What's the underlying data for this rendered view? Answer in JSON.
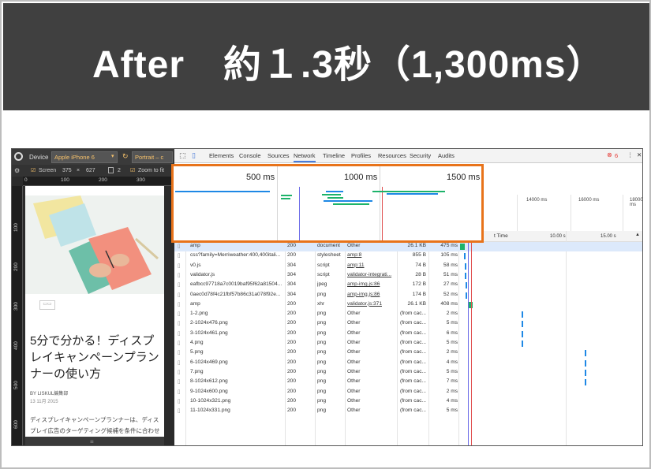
{
  "banner": {
    "title": "After　約１.3秒（1,300ms）"
  },
  "device": {
    "device_label": "Device",
    "device_value": "Apple iPhone 6",
    "orientation": "Portrait – c",
    "screen_label": "Screen",
    "width": "375",
    "times": "×",
    "height": "627",
    "dpr": "2",
    "zoom_label": "Zoom to fit",
    "ruler_top": [
      "0",
      "100",
      "200",
      "300"
    ],
    "ruler_left": [
      "100",
      "200",
      "300",
      "400",
      "500",
      "600"
    ]
  },
  "article": {
    "title": "5分で分かる！ディスプレイキャンペーンプランナーの使い方",
    "byline": "BY LISKUL編集部",
    "date": "13 11月 2015",
    "excerpt": "ディスプレイキャンペーンプランナーは、ディスプレイ広告のターゲティング候補を条件に合わせてリ"
  },
  "devtools": {
    "tabs": [
      "Elements",
      "Console",
      "Sources",
      "Network",
      "Timeline",
      "Profiles",
      "Resources",
      "Security",
      "Audits"
    ],
    "active_tab": "Network",
    "error_count": "6",
    "timeline_labels": [
      "14000 ms",
      "16000 ms",
      "18000 ms"
    ],
    "waterfall_header": "t Time",
    "waterfall_ticks": [
      "10.00 s",
      "15.00 s"
    ],
    "highlight_labels": [
      "500 ms",
      "1000 ms",
      "1500 ms"
    ],
    "rows": [
      {
        "name": "amp",
        "status": "200",
        "type": "document",
        "initiator": "Other",
        "size": "26.1 KB",
        "time": "475 ms"
      },
      {
        "name": "css?family=Merriweather:400,400itali...",
        "status": "200",
        "type": "stylesheet",
        "initiator": "amp:8",
        "size": "855 B",
        "time": "105 ms"
      },
      {
        "name": "v0.js",
        "status": "304",
        "type": "script",
        "initiator": "amp:11",
        "size": "74 B",
        "time": "58 ms"
      },
      {
        "name": "validator.js",
        "status": "304",
        "type": "script",
        "initiator": "validator-integrati...",
        "size": "28 B",
        "time": "51 ms"
      },
      {
        "name": "eafbcc97718a7c0019baf95f62a81504...",
        "status": "304",
        "type": "jpeg",
        "initiator": "amp-img.js:86",
        "size": "172 B",
        "time": "27 ms"
      },
      {
        "name": "0aec0d78f4c21fbf57b86c31a078f92e...",
        "status": "304",
        "type": "png",
        "initiator": "amp-img.js:86",
        "size": "174 B",
        "time": "52 ms"
      },
      {
        "name": "amp",
        "status": "200",
        "type": "xhr",
        "initiator": "validator.js:371",
        "size": "26.1 KB",
        "time": "408 ms"
      },
      {
        "name": "1-2.png",
        "status": "200",
        "type": "png",
        "initiator": "Other",
        "size": "(from cac...",
        "time": "2 ms"
      },
      {
        "name": "2-1024x476.png",
        "status": "200",
        "type": "png",
        "initiator": "Other",
        "size": "(from cac...",
        "time": "5 ms"
      },
      {
        "name": "3-1024x461.png",
        "status": "200",
        "type": "png",
        "initiator": "Other",
        "size": "(from cac...",
        "time": "6 ms"
      },
      {
        "name": "4.png",
        "status": "200",
        "type": "png",
        "initiator": "Other",
        "size": "(from cac...",
        "time": "5 ms"
      },
      {
        "name": "5.png",
        "status": "200",
        "type": "png",
        "initiator": "Other",
        "size": "(from cac...",
        "time": "2 ms"
      },
      {
        "name": "6-1024x469.png",
        "status": "200",
        "type": "png",
        "initiator": "Other",
        "size": "(from cac...",
        "time": "4 ms"
      },
      {
        "name": "7.png",
        "status": "200",
        "type": "png",
        "initiator": "Other",
        "size": "(from cac...",
        "time": "5 ms"
      },
      {
        "name": "8-1024x612.png",
        "status": "200",
        "type": "png",
        "initiator": "Other",
        "size": "(from cac...",
        "time": "7 ms"
      },
      {
        "name": "9-1024x600.png",
        "status": "200",
        "type": "png",
        "initiator": "Other",
        "size": "(from cac...",
        "time": "2 ms"
      },
      {
        "name": "10-1024x321.png",
        "status": "200",
        "type": "png",
        "initiator": "Other",
        "size": "(from cac...",
        "time": "4 ms"
      },
      {
        "name": "11-1024x331.png",
        "status": "200",
        "type": "png",
        "initiator": "Other",
        "size": "(from cac...",
        "time": "5 ms"
      }
    ]
  },
  "colors": {
    "banner_bg": "#404040",
    "highlight": "#e8731a",
    "bar_green": "#1db36a",
    "bar_blue": "#1e88e5",
    "active_tab": "#4a7bd9"
  }
}
